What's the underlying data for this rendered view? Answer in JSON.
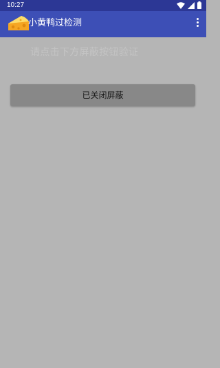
{
  "status_bar": {
    "time": "10:27",
    "icons": [
      "wifi-icon",
      "signal-icon",
      "battery-icon"
    ]
  },
  "app_bar": {
    "title": "小黄鸭过检测",
    "icon": "cheese-icon",
    "menu_icon": "more-vertical-icon",
    "background": "#3d4fb6"
  },
  "main": {
    "hint_text": "请点击下方屏蔽按钮验证",
    "close_shield_button_label": "已关闭屏蔽",
    "background": "#b5b5b5"
  }
}
